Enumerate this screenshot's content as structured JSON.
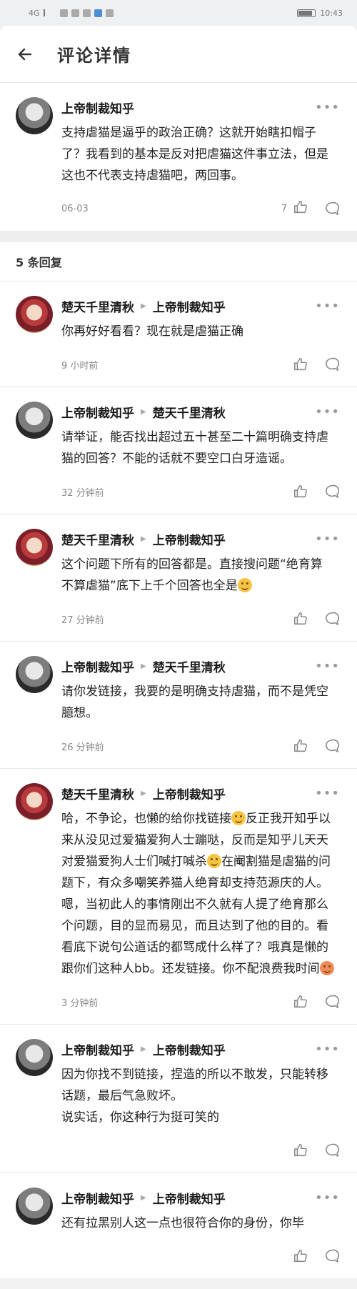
{
  "status_bar": {
    "network": "4G",
    "time": "10:43"
  },
  "header": {
    "title": "评论详情"
  },
  "main_comment": {
    "author": "上帝制裁知乎",
    "text": "支持虐猫是逼乎的政治正确？这就开始瞎扣帽子了？我看到的基本是反对把虐猫这件事立法，但是这也不代表支持虐猫吧，两回事。",
    "date": "06-03",
    "likes": "7"
  },
  "replies_count_label": "5 条回复",
  "replies": [
    {
      "author": "楚天千里清秋",
      "reply_to": "上帝制裁知乎",
      "avatar": "girl",
      "text": "你再好好看看？现在就是虐猫正确",
      "time": "9 小时前"
    },
    {
      "author": "上帝制裁知乎",
      "reply_to": "楚天千里清秋",
      "avatar": "man",
      "text": "请举证，能否找出超过五十甚至二十篇明确支持虐猫的回答？不能的话就不要空口白牙造谣。",
      "time": "32 分钟前"
    },
    {
      "author": "楚天千里清秋",
      "reply_to": "上帝制裁知乎",
      "avatar": "girl",
      "text": "这个问题下所有的回答都是。直接搜问题“绝育算不算虐猫”底下上千个回答也全是",
      "emoji_end": true,
      "time": "27 分钟前"
    },
    {
      "author": "上帝制裁知乎",
      "reply_to": "楚天千里清秋",
      "avatar": "man",
      "text": "请你发链接，我要的是明确支持虐猫，而不是凭空臆想。",
      "time": "26 分钟前"
    },
    {
      "author": "楚天千里清秋",
      "reply_to": "上帝制裁知乎",
      "avatar": "girl",
      "text_parts": [
        "哈，不争论，也懒的给你找链接",
        "反正我开知乎以来从没见过爱猫爱狗人士蹦哒，反而是知乎儿天天对爱猫爱狗人士们喊打喊杀",
        "在阉割猫是虐猫的问题下，有众多嘲笑养猫人绝育却支持范源庆的人。嗯，当初此人的事情刚出不久就有人提了绝育那么个问题，目的显而易见，而且达到了他的目的。看看底下说句公道话的都骂成什么样了？哦真是懒的跟你们这种人bb。还发链接。你不配浪费我时间"
      ],
      "time": "3 分钟前"
    },
    {
      "author": "上帝制裁知乎",
      "reply_to": "上帝制裁知乎",
      "avatar": "man",
      "text": "因为你找不到链接，捏造的所以不敢发，只能转移话题，最后气急败坏。\n说实话，你这种行为挺可笑的",
      "time": ""
    },
    {
      "author": "上帝制裁知乎",
      "reply_to": "上帝制裁知乎",
      "avatar": "man",
      "text": "还有拉黑别人这一点也很符合你的身份，你毕",
      "time": ""
    }
  ],
  "colors": {
    "background": "#ffffff",
    "separator": "#eeeeee",
    "muted": "#888888"
  },
  "icons": {
    "back": "arrow-left-icon",
    "more": "more-dots-icon",
    "like": "thumb-up-icon",
    "reply": "speech-bubble-icon"
  }
}
